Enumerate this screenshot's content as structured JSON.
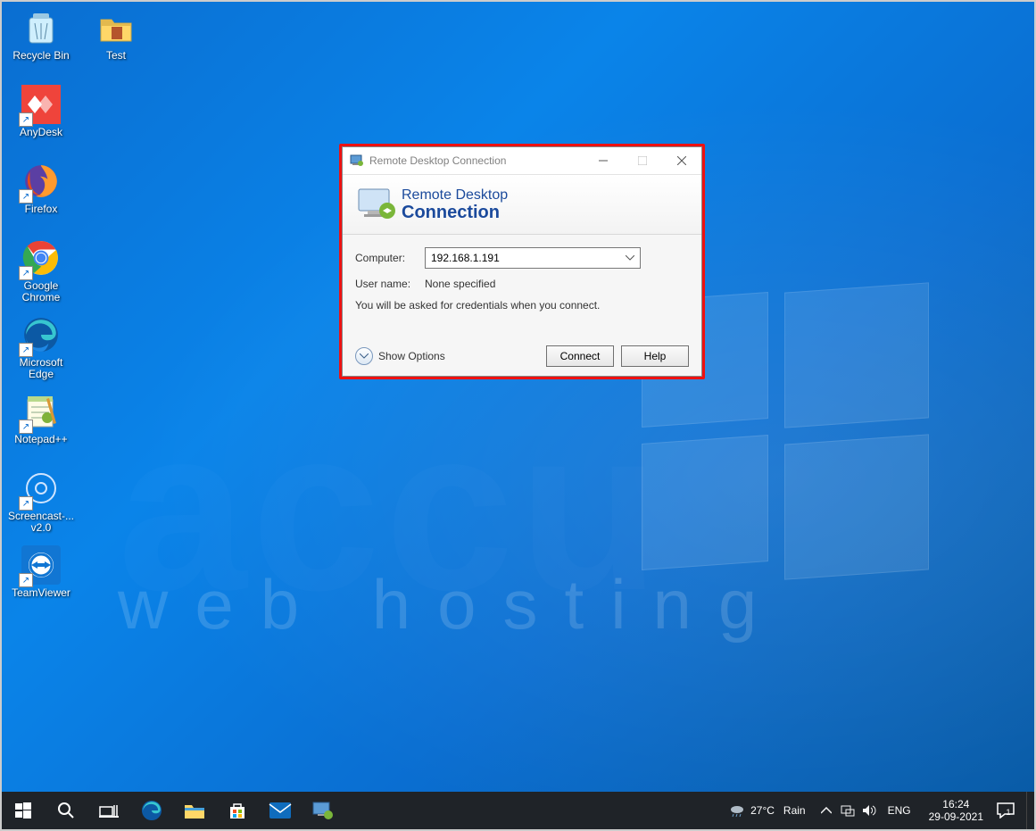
{
  "desktop": {
    "icons_col1": [
      {
        "label": "Recycle Bin",
        "name": "recycle-bin-icon"
      },
      {
        "label": "AnyDesk",
        "name": "anydesk-icon"
      },
      {
        "label": "Firefox",
        "name": "firefox-icon"
      },
      {
        "label": "Google Chrome",
        "name": "chrome-icon"
      },
      {
        "label": "Microsoft Edge",
        "name": "edge-icon"
      },
      {
        "label": "Notepad++",
        "name": "notepadpp-icon"
      },
      {
        "label": "Screencast-... v2.0",
        "name": "screencast-icon"
      },
      {
        "label": "TeamViewer",
        "name": "teamviewer-icon"
      }
    ],
    "icons_col2": [
      {
        "label": "Test",
        "name": "folder-icon"
      }
    ],
    "watermark_main": "accu",
    "watermark_sub": "web hosting"
  },
  "rdc": {
    "title": "Remote Desktop Connection",
    "banner_line1": "Remote Desktop",
    "banner_line2": "Connection",
    "computer_label": "Computer:",
    "computer_value": "192.168.1.191",
    "username_label": "User name:",
    "username_value": "None specified",
    "hint": "You will be asked for credentials when you connect.",
    "show_options": "Show Options",
    "connect": "Connect",
    "help": "Help"
  },
  "taskbar": {
    "weather_temp": "27°C",
    "weather_cond": "Rain",
    "lang": "ENG",
    "time": "16:24",
    "date": "29-09-2021",
    "notif_count": "1"
  }
}
